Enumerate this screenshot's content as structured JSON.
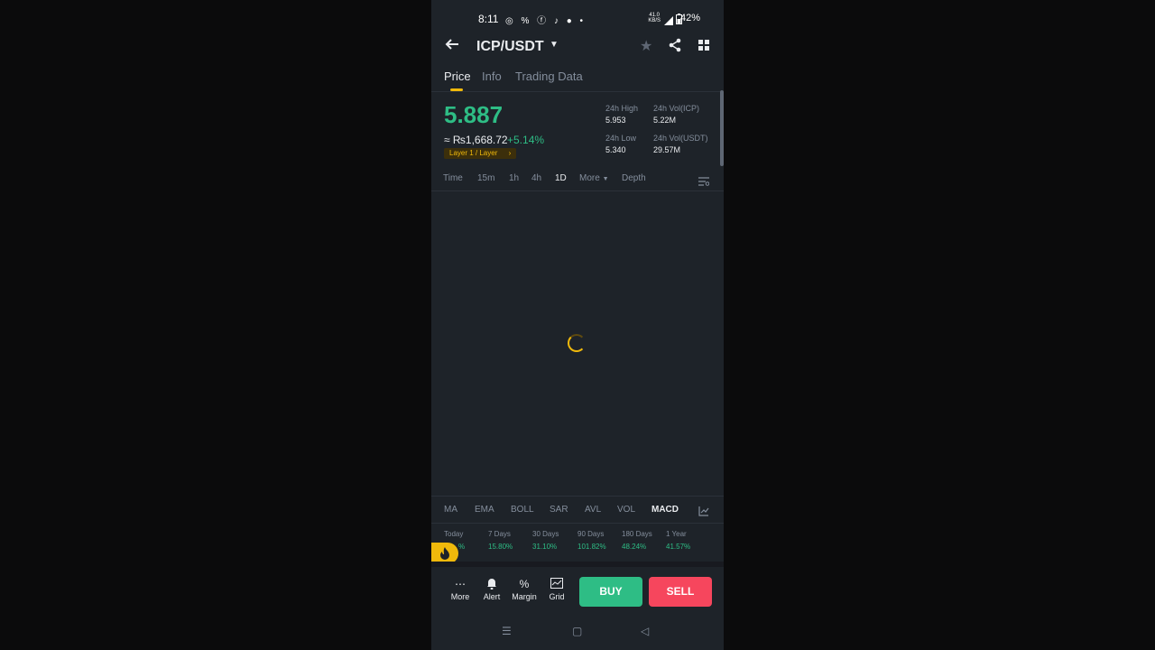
{
  "status_bar": {
    "time": "8:11",
    "notification_icons": "◎ % ⓕ ♪ ●  •",
    "net_speed_line1": "41.0",
    "net_speed_line2": "KB/S",
    "battery": "42%"
  },
  "header": {
    "pair": "ICP/USDT",
    "back_icon": "arrow-left-icon",
    "star_icon": "star-icon",
    "share_icon": "share-icon",
    "grid_icon": "grid-icon"
  },
  "tabs": [
    {
      "label": "Price",
      "active": true
    },
    {
      "label": "Info",
      "active": false
    },
    {
      "label": "Trading Data",
      "active": false
    }
  ],
  "ticker": {
    "price": "5.887",
    "fiat": "≈ ₨1,668.72",
    "change": "+5.14%",
    "tag": "Layer 1 / Layer",
    "high_label": "24h High",
    "high_value": "5.953",
    "low_label": "24h Low",
    "low_value": "5.340",
    "vol_icp_label": "24h Vol(ICP)",
    "vol_icp_value": "5.22M",
    "vol_usdt_label": "24h Vol(USDT)",
    "vol_usdt_value": "29.57M"
  },
  "intervals": [
    "Time",
    "15m",
    "1h",
    "4h",
    "1D",
    "More",
    "Depth"
  ],
  "active_interval": "1D",
  "indicators": [
    "MA",
    "EMA",
    "BOLL",
    "SAR",
    "AVL",
    "VOL",
    "MACD"
  ],
  "active_indicator": "MACD",
  "performance": [
    {
      "label": "Today",
      "value": "%"
    },
    {
      "label": "7 Days",
      "value": "15.80%"
    },
    {
      "label": "30 Days",
      "value": "31.10%"
    },
    {
      "label": "90 Days",
      "value": "101.82%"
    },
    {
      "label": "180 Days",
      "value": "48.24%"
    },
    {
      "label": "1 Year",
      "value": "41.57%"
    }
  ],
  "bottom_nav": {
    "more": "More",
    "alert": "Alert",
    "margin": "Margin",
    "grid": "Grid",
    "buy": "BUY",
    "sell": "SELL"
  },
  "colors": {
    "background": "#1e2329",
    "accent": "#f0b90b",
    "up": "#2ebd85",
    "down": "#f6465d"
  }
}
